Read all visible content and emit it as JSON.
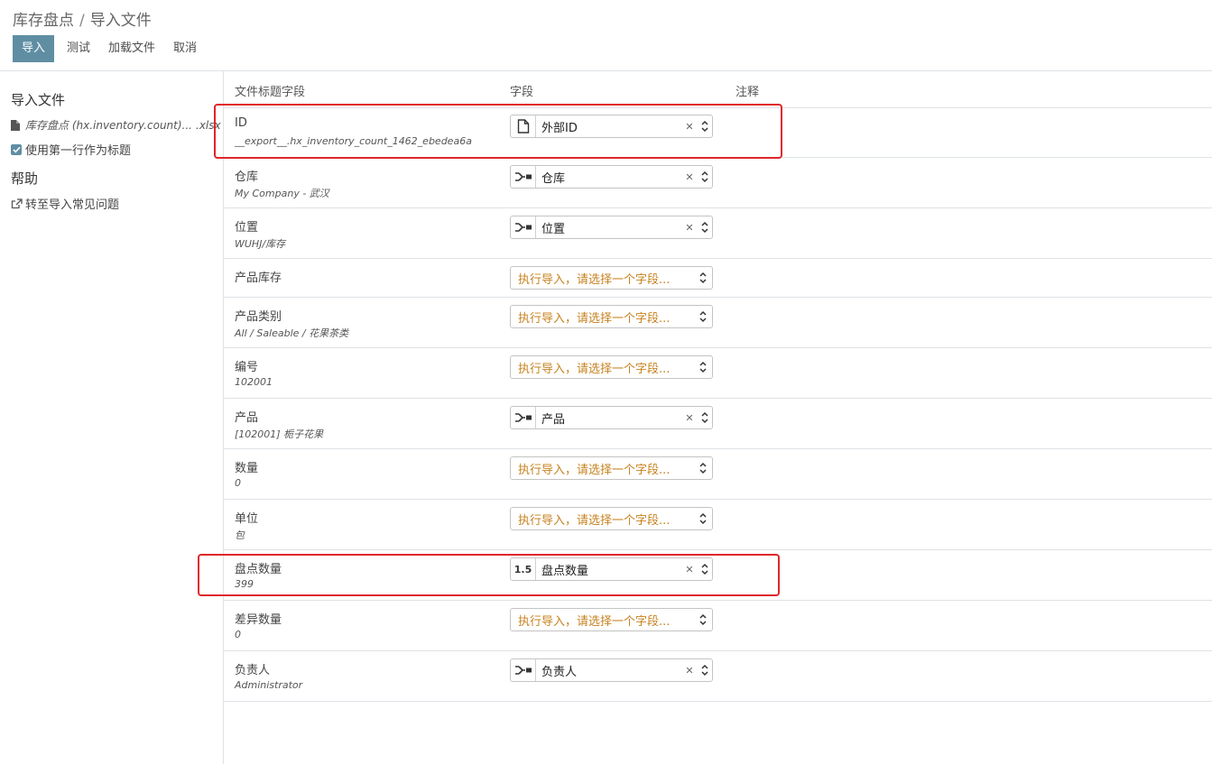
{
  "breadcrumb": {
    "parent": "库存盘点",
    "separator": "/",
    "current": "导入文件"
  },
  "toolbar": {
    "import_label": "导入",
    "test_label": "测试",
    "load_file_label": "加载文件",
    "cancel_label": "取消"
  },
  "sidebar": {
    "import_title": "导入文件",
    "file_name": "库存盘点 (hx.inventory.count)...",
    "file_ext": ".xlsx",
    "first_row_header_label": "使用第一行作为标题",
    "first_row_header_checked": true,
    "help_title": "帮助",
    "faq_link": "转至导入常见问题"
  },
  "table": {
    "headers": {
      "file_column": "文件标题字段",
      "field": "字段",
      "comment": "注释"
    },
    "placeholder": "执行导入，请选择一个字段...",
    "rows": [
      {
        "label": "ID",
        "sample": "__export__.hx_inventory_count_1462_ebedea6a",
        "field": "外部ID",
        "icon": "file-icon"
      },
      {
        "label": "仓库",
        "sample": "My Company - 武汉",
        "field": "仓库",
        "icon": "relation-icon"
      },
      {
        "label": "位置",
        "sample": "WUHJ/库存",
        "field": "位置",
        "icon": "relation-icon"
      },
      {
        "label": "产品库存",
        "sample": "",
        "field": "",
        "icon": ""
      },
      {
        "label": "产品类别",
        "sample": "All / Saleable / 花果茶类",
        "field": "",
        "icon": ""
      },
      {
        "label": "编号",
        "sample": "102001",
        "field": "",
        "icon": ""
      },
      {
        "label": "产品",
        "sample": "[102001] 栀子花果",
        "field": "产品",
        "icon": "relation-icon"
      },
      {
        "label": "数量",
        "sample": "0",
        "field": "",
        "icon": ""
      },
      {
        "label": "单位",
        "sample": "包",
        "field": "",
        "icon": ""
      },
      {
        "label": "盘点数量",
        "sample": "399",
        "field": "盘点数量",
        "icon": "float-icon",
        "icon_text": "1.5"
      },
      {
        "label": "差异数量",
        "sample": "0",
        "field": "",
        "icon": ""
      },
      {
        "label": "负责人",
        "sample": "Administrator",
        "field": "负责人",
        "icon": "relation-icon"
      }
    ]
  },
  "colors": {
    "primary": "#5f8ea3",
    "placeholder": "#c7821f",
    "highlight": "#e0262a",
    "border": "#dee2e6"
  }
}
